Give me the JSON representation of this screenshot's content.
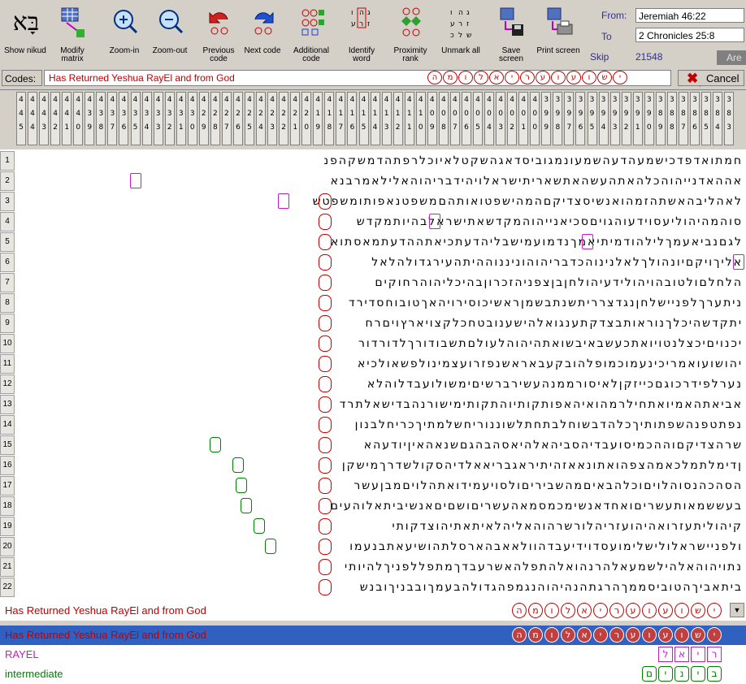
{
  "toolbar": {
    "buttons": [
      {
        "id": "show-nikud",
        "label": "Show nikud",
        "icon": "aleph-bet-icon"
      },
      {
        "id": "modify-matrix",
        "label": "Modify matrix",
        "icon": "matrix-grid-icon"
      },
      {
        "id": "zoom-in",
        "label": "Zoom-in",
        "icon": "zoom-in-icon"
      },
      {
        "id": "zoom-out",
        "label": "Zoom-out",
        "icon": "zoom-out-icon"
      },
      {
        "id": "previous-code",
        "label": "Previous code",
        "icon": "previous-arrow-icon"
      },
      {
        "id": "next-code",
        "label": "Next code",
        "icon": "next-arrow-icon"
      },
      {
        "id": "additional-code",
        "label": "Additional code",
        "icon": "additional-code-icon"
      },
      {
        "id": "identify-word",
        "label": "Identify word",
        "icon": "identify-word-icon"
      },
      {
        "id": "proximity-rank",
        "label": "Proximity rank",
        "icon": "proximity-icon"
      },
      {
        "id": "unmark-all",
        "label": "Unmark all",
        "icon": "unmark-icon"
      },
      {
        "id": "save-screen",
        "label": "Save screen",
        "icon": "save-disk-icon"
      },
      {
        "id": "print-screen",
        "label": "Print screen",
        "icon": "printer-icon"
      }
    ],
    "logo_text": "בָּא",
    "from_label": "From:",
    "to_label": "To",
    "from_value": "Jeremiah 46:22",
    "to_value": "2 Chronicles 25:8",
    "skip_label": "Skip",
    "skip_value": "21548",
    "are_text": "Are"
  },
  "codes": {
    "label": "Codes:",
    "text": "Has Returned Yeshua RayEl and from God",
    "hebrew_letters": [
      "י",
      "ש",
      "ו",
      "ע",
      "ו",
      "ע",
      "ר",
      "י",
      "א",
      "ל",
      "ו",
      "מ",
      "ה"
    ],
    "cancel_label": "Cancel"
  },
  "column_headers": [
    [
      "4",
      "4",
      "5"
    ],
    [
      "4",
      "4",
      "4"
    ],
    [
      "4",
      "4",
      "3"
    ],
    [
      "4",
      "4",
      "2"
    ],
    [
      "4",
      "4",
      "1"
    ],
    [
      "4",
      "4",
      "0"
    ],
    [
      "4",
      "3",
      "9"
    ],
    [
      "4",
      "3",
      "8"
    ],
    [
      "4",
      "3",
      "7"
    ],
    [
      "4",
      "3",
      "6"
    ],
    [
      "4",
      "3",
      "5"
    ],
    [
      "4",
      "3",
      "4"
    ],
    [
      "4",
      "3",
      "3"
    ],
    [
      "4",
      "3",
      "2"
    ],
    [
      "4",
      "3",
      "1"
    ],
    [
      "4",
      "3",
      "0"
    ],
    [
      "4",
      "2",
      "9"
    ],
    [
      "4",
      "2",
      "8"
    ],
    [
      "4",
      "2",
      "7"
    ],
    [
      "4",
      "2",
      "6"
    ],
    [
      "4",
      "2",
      "5"
    ],
    [
      "4",
      "2",
      "4"
    ],
    [
      "4",
      "2",
      "3"
    ],
    [
      "4",
      "2",
      "2"
    ],
    [
      "4",
      "2",
      "1"
    ],
    [
      "4",
      "2",
      "0"
    ],
    [
      "4",
      "1",
      "9"
    ],
    [
      "4",
      "1",
      "8"
    ],
    [
      "4",
      "1",
      "7"
    ],
    [
      "4",
      "1",
      "6"
    ],
    [
      "4",
      "1",
      "5"
    ],
    [
      "4",
      "1",
      "4"
    ],
    [
      "4",
      "1",
      "3"
    ],
    [
      "4",
      "1",
      "2"
    ],
    [
      "4",
      "1",
      "1"
    ],
    [
      "4",
      "1",
      "0"
    ],
    [
      "4",
      "0",
      "9"
    ],
    [
      "4",
      "0",
      "8"
    ],
    [
      "4",
      "0",
      "7"
    ],
    [
      "4",
      "0",
      "6"
    ],
    [
      "4",
      "0",
      "5"
    ],
    [
      "4",
      "0",
      "4"
    ],
    [
      "4",
      "0",
      "3"
    ],
    [
      "4",
      "0",
      "2"
    ],
    [
      "4",
      "0",
      "1"
    ],
    [
      "4",
      "0",
      "0"
    ],
    [
      "3",
      "9",
      "9"
    ],
    [
      "3",
      "9",
      "8"
    ],
    [
      "3",
      "9",
      "7"
    ],
    [
      "3",
      "9",
      "6"
    ],
    [
      "3",
      "9",
      "5"
    ],
    [
      "3",
      "9",
      "4"
    ],
    [
      "3",
      "9",
      "3"
    ],
    [
      "3",
      "9",
      "2"
    ],
    [
      "3",
      "9",
      "1"
    ],
    [
      "3",
      "9",
      "0"
    ],
    [
      "3",
      "8",
      "9"
    ],
    [
      "3",
      "8",
      "8"
    ],
    [
      "3",
      "8",
      "7"
    ],
    [
      "3",
      "8",
      "6"
    ],
    [
      "3",
      "8",
      "5"
    ],
    [
      "3",
      "8",
      "4"
    ],
    [
      "3",
      "8",
      "3"
    ]
  ],
  "grid_rows": [
    {
      "n": "1",
      "text": "חמתואדפדכישמעהדעהשמעונמגוביסדאגהשקטלאיוכלרפתהדמשקהפנ"
    },
    {
      "n": "2",
      "text": "אההאדנייהוהכלהאתהעשהאתשאריתישראלויהידבריהוהאלילאמרבנא"
    },
    {
      "n": "3",
      "text": "לאהליבהאשתהזמהואנשיסצדיקםהמהישפטואותהםמשפטנאפותומשפטש"
    },
    {
      "n": "4",
      "text": "סוהמהיהוליעסוידעוהגויםסכיאנייהוהמקדשאתישראלבהיותמקדש"
    },
    {
      "n": "5",
      "text": "לגםנביאעמךלילהודמיתיאמךנדמועמישבליהדעתכיאתההדעתמאסתוא"
    },
    {
      "n": "6",
      "text": "אליךויקםיונהולךלאלנינוהכדבריהוהוניננוההיתהעירגדולהלאל"
    },
    {
      "n": "7",
      "text": "הלחלםולטובהויהולידעיהולחןבןצפניהזכרוןבהיכליהוהרחוקים"
    },
    {
      "n": "8",
      "text": "ניתערךלפניישלחןנגדצרריתשנתבשמןראשיכוסירויהאךטובוחסדירד"
    },
    {
      "n": "9",
      "text": "יתקדשהיכלךנוראותבצדקתענגואלהישענובטחכלקצויארץויםרח"
    },
    {
      "n": "10",
      "text": "יכנויםיכצלנטויואתכעשבאיבשואתהיהוהלעולםתשבודורךלדורדור"
    },
    {
      "n": "11",
      "text": "יהושועואמריכינעמוכמופלהובקעבאראשנפזרועצמינולפשאולכיא"
    },
    {
      "n": "12",
      "text": "נערלפידרכוגםכייזקןלאיסורממנהעשירברשיםימשולועבדלוהלא"
    },
    {
      "n": "13",
      "text": "אביאתהאמיואתחילרמהואיהאפותקותיוהתקותימישורנהבדישאלתרד"
    },
    {
      "n": "14",
      "text": "נפתטפנהשפתותיךכלהדבשוחלבתחתלשוננוריחשלמתיךכריחלבנון"
    },
    {
      "n": "15",
      "text": "שרהצדיקםוההכמיסועבדיהסביהאלהיאסהבהגםשנאהאיןיודעהא"
    },
    {
      "n": "16",
      "text": "ןדימלתמלכאמהצפהואתונאאזהיתיראגבריאאלדיהסקולשדרךמישקן"
    },
    {
      "n": "17",
      "text": "הסהכהנסוהלויםוכלהבאיםמהשביריםולסויעמידואתהלויםמבןעשר"
    },
    {
      "n": "18",
      "text": "בעששמאותעשריםואחדאנשימכמסמאהעשריםושםיםאנשיביתאלוהעים"
    },
    {
      "n": "19",
      "text": "קיהוליתעזרואהיהועזריהלורשרהוהאליהלאיתאתיהוצדקותי"
    },
    {
      "n": "20",
      "text": "ולפניישראלולישלימועסדוידיעבדהוולאאבהארסלתהושיעאתבנעמו"
    },
    {
      "n": "21",
      "text": "נתויהוהאלהילשמעאלהרנהואלהתפלהאשרעבדךמתפללפניךלהיותי"
    },
    {
      "n": "22",
      "text": "ביתאביךהטוביסממךהרגתהנהיהוהנגמפהגדולהבעמךובבניךובנש"
    }
  ],
  "results": [
    {
      "text": "Has Returned Yeshua RayEl and from God",
      "color": "#c00000",
      "letters": [
        "י",
        "ש",
        "ו",
        "ע",
        "ו",
        "ע",
        "ר",
        "י",
        "א",
        "ל",
        "ו",
        "מ",
        "ה"
      ]
    },
    {
      "text": "Has Returned Yeshua RayEl and from God",
      "color": "#c00000",
      "letters": [
        "י",
        "ש",
        "ו",
        "ע",
        "ו",
        "ע",
        "ר",
        "י",
        "א",
        "ל",
        "ו",
        "מ",
        "ה"
      ]
    },
    {
      "text": "RAYEL",
      "color": "#c020c0",
      "letters": [
        "ר",
        "י",
        "א",
        "ל"
      ]
    },
    {
      "text": "intermediate",
      "color": "#008000",
      "letters": [
        "ב",
        "י",
        "נ",
        "י",
        "ם"
      ]
    }
  ],
  "colors": {
    "code_red": "#c00000",
    "selection_blue": "#3060c0",
    "rayel_magenta": "#c020c0",
    "intermediate_green": "#008000"
  }
}
